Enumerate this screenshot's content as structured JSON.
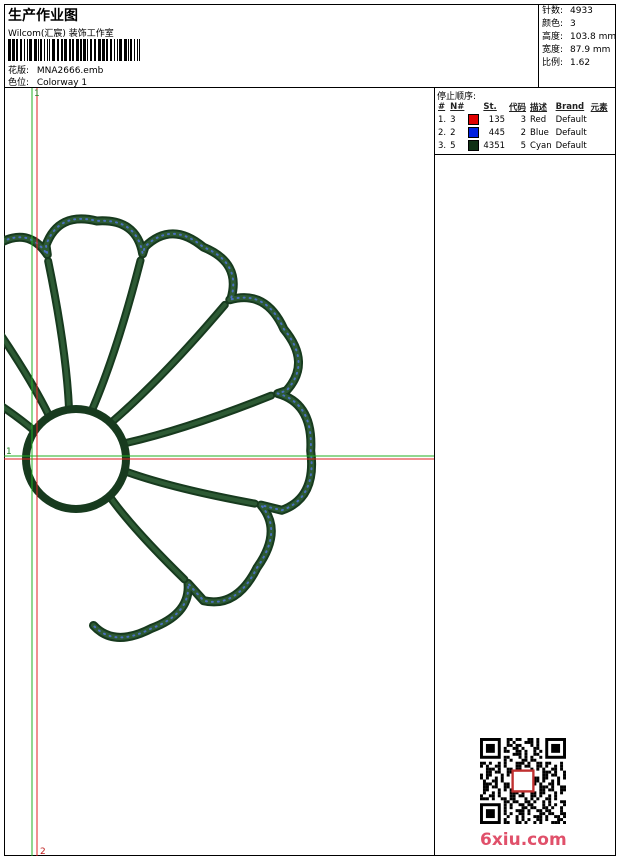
{
  "header": {
    "title": "生产作业图",
    "company": "Wilcom(汇宸) 装饰工作室",
    "design_label": "花版:",
    "design_value": "MNA2666.emb",
    "colorway_label": "色位:",
    "colorway_value": "Colorway 1"
  },
  "stats": [
    {
      "label": "针数:",
      "value": "4933"
    },
    {
      "label": "颜色:",
      "value": "3"
    },
    {
      "label": "高度:",
      "value": "103.8 mm"
    },
    {
      "label": "宽度:",
      "value": "87.9 mm"
    },
    {
      "label": "比例:",
      "value": "1.62"
    }
  ],
  "stop_sequence": {
    "title": "停止顺序:",
    "columns": [
      "#",
      "N#",
      "St.",
      "代码",
      "描述",
      "Brand",
      "元素"
    ],
    "rows": [
      {
        "idx": "1.",
        "n": "3",
        "color": "#e00000",
        "st": "135",
        "code": "3",
        "desc": "Red",
        "brand": "Default"
      },
      {
        "idx": "2.",
        "n": "2",
        "color": "#0020e0",
        "st": "445",
        "code": "2",
        "desc": "Blue",
        "brand": "Default"
      },
      {
        "idx": "3.",
        "n": "5",
        "color": "#0f3014",
        "st": "4351",
        "code": "5",
        "desc": "Cyan",
        "brand": "Default"
      }
    ]
  },
  "canvas": {
    "guide_h_label": "1",
    "guide_v_label": "1",
    "guide_v2_label": "2",
    "stitch_color": "#173a1e",
    "guide_red": "#e02020",
    "guide_green": "#20b020"
  },
  "watermark": "6xiu.com"
}
